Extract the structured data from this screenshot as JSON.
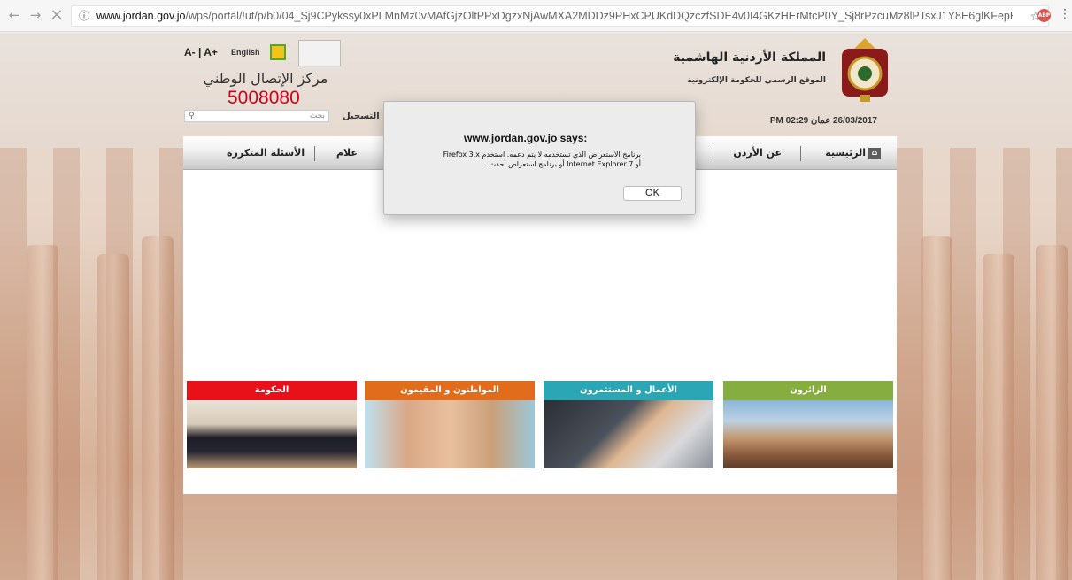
{
  "browser": {
    "url_domain": "www.jordan.gov.jo",
    "url_path": "/wps/portal/!ut/p/b0/04_Sj9CPykssy0xPLMnMz0vMAfGjzOltPPxDgzxNjAwMXA2MDDz9PHxCPUKdDQzczfSDE4v0I4GKzHErMtcP0Y_Sj8rPzcuMz8lPTsxJ1Y8E6glKFepH5...",
    "info_icon": "info-icon",
    "back_icon": "←",
    "forward_icon": "→",
    "stop_icon": "×",
    "star_icon": "☆",
    "adblock_label": "ABP",
    "menu_icon": "⋮"
  },
  "header": {
    "font_size_controls": "A- | A+",
    "language_link": "English",
    "call_center_label": "مركز الإتصال الوطني",
    "call_center_number": "5008080",
    "search_placeholder": "بحث",
    "register_label": "التسجيل",
    "kingdom_title": "المملكة الأردنية الهاشمية",
    "site_subtitle": "الموقع الرسمي للحكومة الإلكترونية",
    "datetime": "26/03/2017   عمان 02:29 PM"
  },
  "navbar": {
    "home": "الرئيسية",
    "about": "عن الأردن",
    "media": "علام",
    "faq": "الأسئلة المتكررة"
  },
  "tiles": [
    {
      "label": "الحكومة",
      "color": "#e8111a"
    },
    {
      "label": "المواطنون و المقيمون",
      "color": "#e06c1c"
    },
    {
      "label": "الأعمال و المستثمرون",
      "color": "#2aa6b5"
    },
    {
      "label": "الزائرون",
      "color": "#86ad3f"
    }
  ],
  "dialog": {
    "title": "www.jordan.gov.jo says:",
    "message": "برنامج الاستعراض الذي تستخدمه لا يتم دعمه. استخدم Firefox 3.x أو Internet Explorer 7 أو برنامج استعراض أحدث.",
    "ok_label": "OK"
  }
}
